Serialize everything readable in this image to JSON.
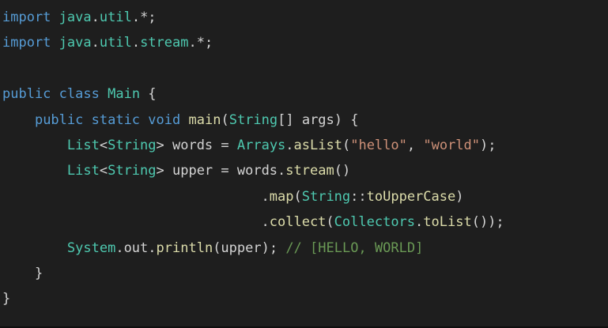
{
  "theme": {
    "background": "#1e1e1e",
    "keyword": "#569cd6",
    "type": "#4ec9b0",
    "function": "#dcdcaa",
    "string": "#ce9178",
    "text": "#d4d4d4",
    "comment": "#6a9955"
  },
  "code_lines": [
    {
      "tokens": [
        [
          "import",
          "k-blue"
        ],
        [
          " ",
          "k-var"
        ],
        [
          "java",
          "k-type"
        ],
        [
          ".",
          "k-punc"
        ],
        [
          "util",
          "k-type"
        ],
        [
          ".*;",
          "k-punc"
        ]
      ]
    },
    {
      "tokens": [
        [
          "import",
          "k-blue"
        ],
        [
          " ",
          "k-var"
        ],
        [
          "java",
          "k-type"
        ],
        [
          ".",
          "k-punc"
        ],
        [
          "util",
          "k-type"
        ],
        [
          ".",
          "k-punc"
        ],
        [
          "stream",
          "k-type"
        ],
        [
          ".*;",
          "k-punc"
        ]
      ]
    },
    {
      "tokens": []
    },
    {
      "tokens": [
        [
          "public",
          "k-blue"
        ],
        [
          " ",
          "k-var"
        ],
        [
          "class",
          "k-blue"
        ],
        [
          " ",
          "k-var"
        ],
        [
          "Main",
          "k-type"
        ],
        [
          " {",
          "k-punc"
        ]
      ]
    },
    {
      "tokens": [
        [
          "    ",
          "k-var"
        ],
        [
          "public",
          "k-blue"
        ],
        [
          " ",
          "k-var"
        ],
        [
          "static",
          "k-blue"
        ],
        [
          " ",
          "k-var"
        ],
        [
          "void",
          "k-blue"
        ],
        [
          " ",
          "k-var"
        ],
        [
          "main",
          "k-fn"
        ],
        [
          "(",
          "k-punc"
        ],
        [
          "String",
          "k-type"
        ],
        [
          "[] args) {",
          "k-punc"
        ]
      ]
    },
    {
      "tokens": [
        [
          "        ",
          "k-var"
        ],
        [
          "List",
          "k-type"
        ],
        [
          "<",
          "k-punc"
        ],
        [
          "String",
          "k-type"
        ],
        [
          "> words = ",
          "k-punc"
        ],
        [
          "Arrays",
          "k-type"
        ],
        [
          ".",
          "k-punc"
        ],
        [
          "asList",
          "k-fn"
        ],
        [
          "(",
          "k-punc"
        ],
        [
          "\"hello\"",
          "k-str"
        ],
        [
          ", ",
          "k-punc"
        ],
        [
          "\"world\"",
          "k-str"
        ],
        [
          ");",
          "k-punc"
        ]
      ]
    },
    {
      "tokens": [
        [
          "        ",
          "k-var"
        ],
        [
          "List",
          "k-type"
        ],
        [
          "<",
          "k-punc"
        ],
        [
          "String",
          "k-type"
        ],
        [
          "> upper = words.",
          "k-punc"
        ],
        [
          "stream",
          "k-fn"
        ],
        [
          "()",
          "k-punc"
        ]
      ]
    },
    {
      "tokens": [
        [
          "                                .",
          "k-punc"
        ],
        [
          "map",
          "k-fn"
        ],
        [
          "(",
          "k-punc"
        ],
        [
          "String",
          "k-type"
        ],
        [
          "::",
          "k-punc"
        ],
        [
          "toUpperCase",
          "k-fn"
        ],
        [
          ")",
          "k-punc"
        ]
      ]
    },
    {
      "tokens": [
        [
          "                                .",
          "k-punc"
        ],
        [
          "collect",
          "k-fn"
        ],
        [
          "(",
          "k-punc"
        ],
        [
          "Collectors",
          "k-type"
        ],
        [
          ".",
          "k-punc"
        ],
        [
          "toList",
          "k-fn"
        ],
        [
          "());",
          "k-punc"
        ]
      ]
    },
    {
      "tokens": [
        [
          "        ",
          "k-var"
        ],
        [
          "System",
          "k-type"
        ],
        [
          ".",
          "k-punc"
        ],
        [
          "out",
          "k-var"
        ],
        [
          ".",
          "k-punc"
        ],
        [
          "println",
          "k-fn"
        ],
        [
          "(upper); ",
          "k-punc"
        ],
        [
          "// [HELLO, WORLD]",
          "k-com"
        ]
      ]
    },
    {
      "tokens": [
        [
          "    }",
          "k-punc"
        ]
      ]
    },
    {
      "tokens": [
        [
          "}",
          "k-punc"
        ]
      ]
    }
  ]
}
